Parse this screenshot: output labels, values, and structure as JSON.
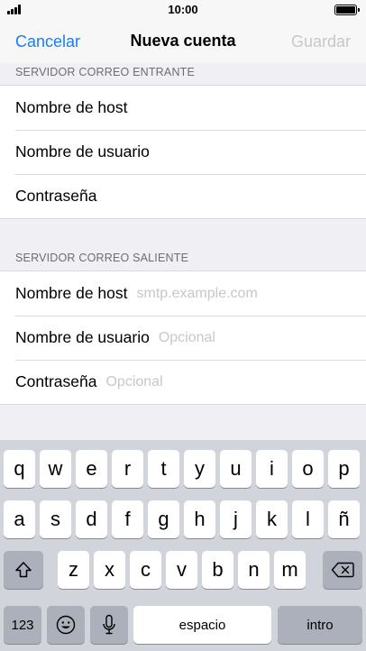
{
  "status": {
    "time": "10:00"
  },
  "nav": {
    "cancel": "Cancelar",
    "title": "Nueva cuenta",
    "save": "Guardar"
  },
  "incoming": {
    "header": "SERVIDOR CORREO ENTRANTE",
    "rows": [
      {
        "label": "Nombre de host",
        "placeholder": ""
      },
      {
        "label": "Nombre de usuario",
        "placeholder": ""
      },
      {
        "label": "Contraseña",
        "placeholder": ""
      }
    ]
  },
  "outgoing": {
    "header": "SERVIDOR CORREO SALIENTE",
    "rows": [
      {
        "label": "Nombre de host",
        "placeholder": "smtp.example.com"
      },
      {
        "label": "Nombre de usuario",
        "placeholder": "Opcional"
      },
      {
        "label": "Contraseña",
        "placeholder": "Opcional"
      }
    ]
  },
  "keyboard": {
    "row1": [
      "q",
      "w",
      "e",
      "r",
      "t",
      "y",
      "u",
      "i",
      "o",
      "p"
    ],
    "row2": [
      "a",
      "s",
      "d",
      "f",
      "g",
      "h",
      "j",
      "k",
      "l",
      "ñ"
    ],
    "row3": [
      "z",
      "x",
      "c",
      "v",
      "b",
      "n",
      "m"
    ],
    "numbers": "123",
    "space": "espacio",
    "return": "intro"
  },
  "icons": {
    "signal": "signal-strength-icon",
    "battery": "battery-icon",
    "shift": "shift-icon",
    "backspace": "backspace-icon",
    "emoji": "emoji-icon",
    "mic": "microphone-icon"
  },
  "colors": {
    "accent": "#1a7ef5",
    "placeholder": "#c7c7cc",
    "background": "#efeff4",
    "keyboard": "#d1d4da"
  }
}
